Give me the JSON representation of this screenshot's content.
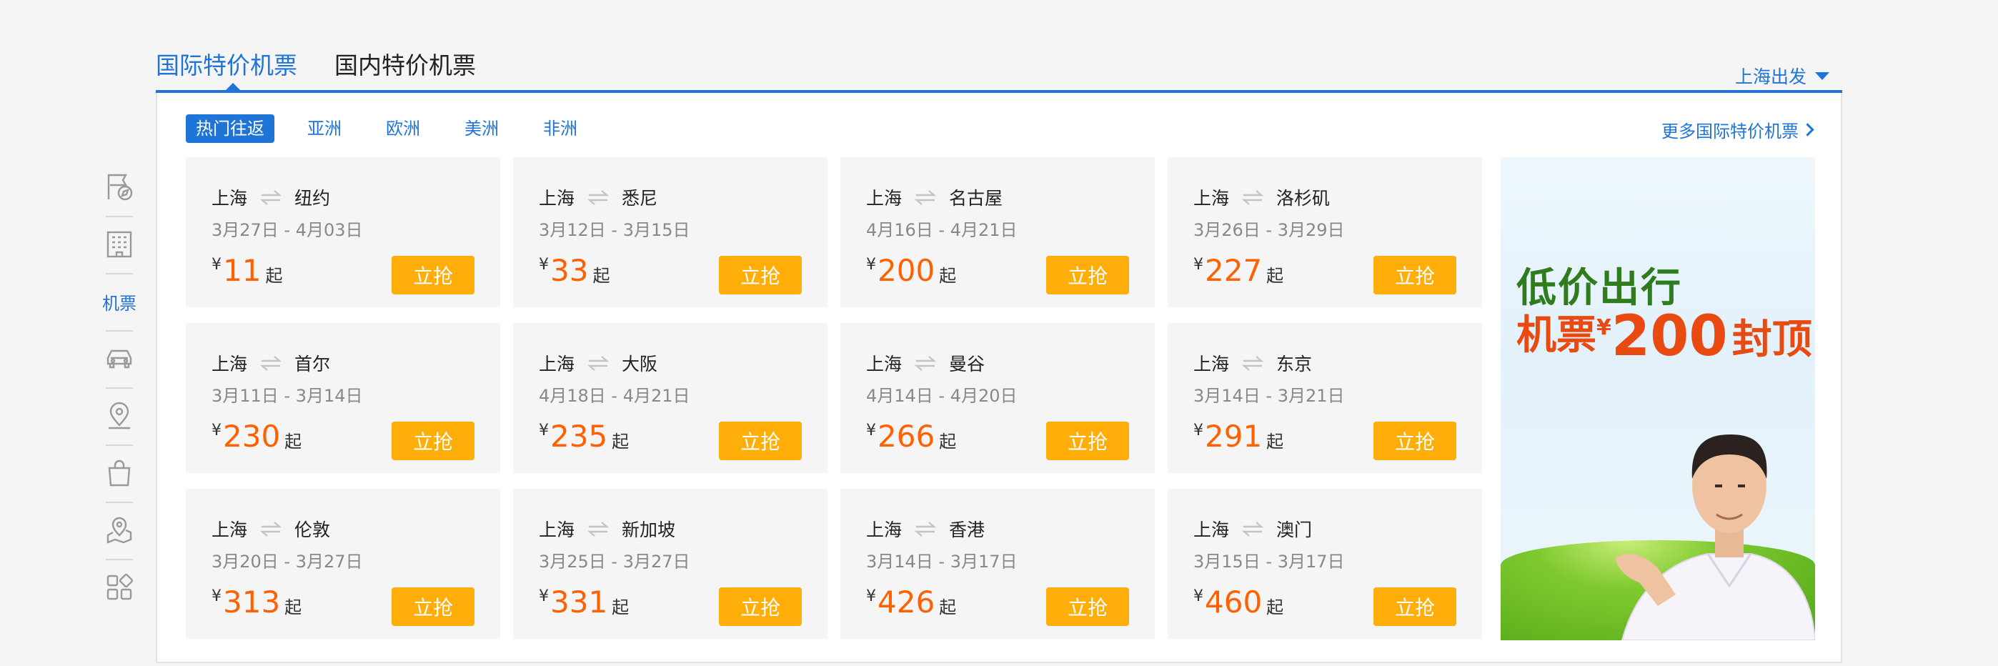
{
  "sidenav": {
    "items": [
      {
        "icon": "flag-compass-icon"
      },
      {
        "icon": "building-icon"
      },
      {
        "label": "机票",
        "active": true
      },
      {
        "icon": "car-icon"
      },
      {
        "icon": "location-pin-icon"
      },
      {
        "icon": "shopping-bag-icon"
      },
      {
        "icon": "map-pin-icon"
      },
      {
        "icon": "apps-grid-icon"
      }
    ]
  },
  "tabs": [
    {
      "label": "国际特价机票",
      "active": true
    },
    {
      "label": "国内特价机票",
      "active": false
    }
  ],
  "departure": {
    "label": "上海出发"
  },
  "filters": [
    {
      "label": "热门往返",
      "active": true
    },
    {
      "label": "亚洲"
    },
    {
      "label": "欧洲"
    },
    {
      "label": "美洲"
    },
    {
      "label": "非洲"
    }
  ],
  "more_link": "更多国际特价机票",
  "currency": "¥",
  "from_suffix": "起",
  "buy_label": "立抢",
  "deals": [
    {
      "from": "上海",
      "to": "纽约",
      "dates": "3月27日 - 4月03日",
      "price": "11"
    },
    {
      "from": "上海",
      "to": "悉尼",
      "dates": "3月12日 - 3月15日",
      "price": "33"
    },
    {
      "from": "上海",
      "to": "名古屋",
      "dates": "4月16日 - 4月21日",
      "price": "200"
    },
    {
      "from": "上海",
      "to": "洛杉矶",
      "dates": "3月26日 - 3月29日",
      "price": "227"
    },
    {
      "from": "上海",
      "to": "首尔",
      "dates": "3月11日 - 3月14日",
      "price": "230"
    },
    {
      "from": "上海",
      "to": "大阪",
      "dates": "4月18日 - 4月21日",
      "price": "235"
    },
    {
      "from": "上海",
      "to": "曼谷",
      "dates": "4月14日 - 4月20日",
      "price": "266"
    },
    {
      "from": "上海",
      "to": "东京",
      "dates": "3月14日 - 3月21日",
      "price": "291"
    },
    {
      "from": "上海",
      "to": "伦敦",
      "dates": "3月20日 - 3月27日",
      "price": "313"
    },
    {
      "from": "上海",
      "to": "新加坡",
      "dates": "3月25日 - 3月27日",
      "price": "331"
    },
    {
      "from": "上海",
      "to": "香港",
      "dates": "3月14日 - 3月17日",
      "price": "426"
    },
    {
      "from": "上海",
      "to": "澳门",
      "dates": "3月15日 - 3月17日",
      "price": "460"
    }
  ],
  "banner": {
    "line1": "低价出行",
    "line2_prefix": "机票",
    "line2_currency": "¥",
    "line2_price": "200",
    "line2_suffix": "封顶"
  },
  "colors": {
    "accent": "#1f74d8",
    "price": "#ff6000",
    "buy_button": "#ffad08"
  }
}
